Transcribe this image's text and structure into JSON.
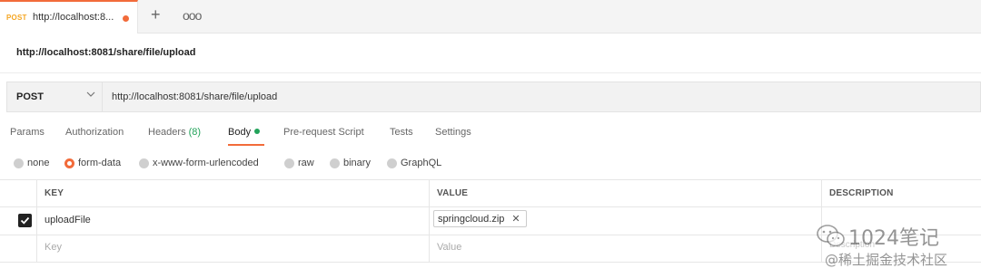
{
  "tab": {
    "method": "POST",
    "title": "http://localhost:8...",
    "new_tab_icon": "plus-icon",
    "more_icon": "ellipsis-icon"
  },
  "request": {
    "name": "http://localhost:8081/share/file/upload",
    "method": "POST",
    "url": "http://localhost:8081/share/file/upload"
  },
  "subtabs": {
    "params": "Params",
    "authorization": "Authorization",
    "headers": "Headers",
    "headers_count": "(8)",
    "body": "Body",
    "prerequest": "Pre-request Script",
    "tests": "Tests",
    "settings": "Settings"
  },
  "body_modes": {
    "none": "none",
    "form_data": "form-data",
    "urlencoded": "x-www-form-urlencoded",
    "raw": "raw",
    "binary": "binary",
    "graphql": "GraphQL",
    "selected": "form-data"
  },
  "table": {
    "headers": {
      "key": "KEY",
      "value": "VALUE",
      "description": "DESCRIPTION"
    },
    "rows": [
      {
        "key": "uploadFile",
        "value": "springcloud.zip",
        "checked": true
      }
    ],
    "placeholder": {
      "key": "Key",
      "value": "Value",
      "description": "Description"
    }
  },
  "watermark": {
    "title": "1024笔记",
    "subtitle": "@稀土掘金技术社区"
  },
  "colors": {
    "accent": "#f26b3a",
    "method_tab": "#f5a623",
    "success": "#22a35a"
  }
}
